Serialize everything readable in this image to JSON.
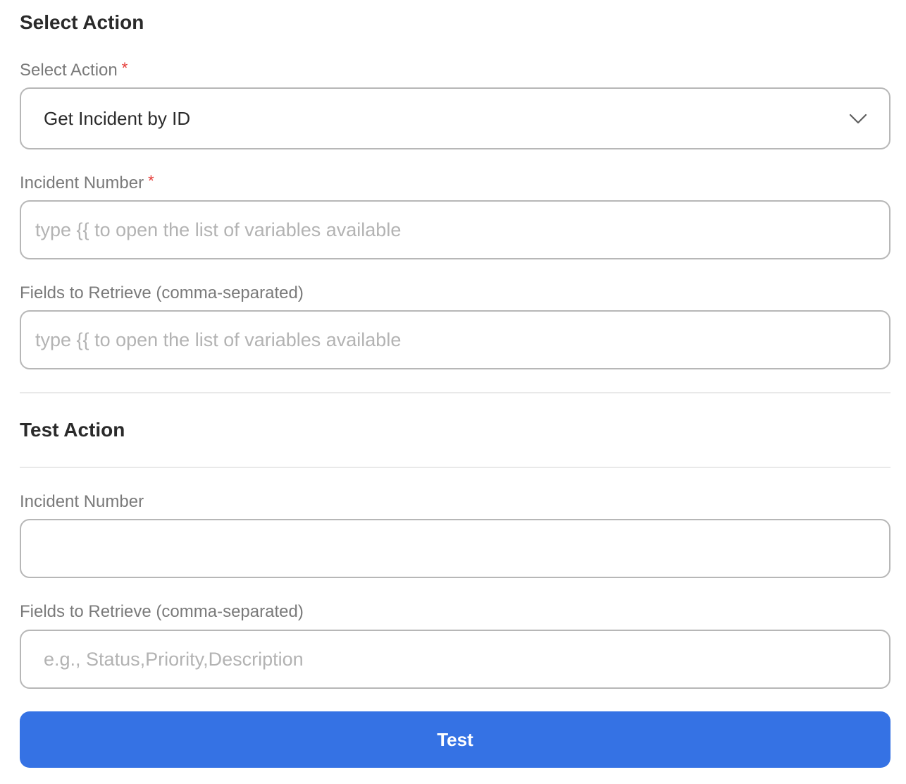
{
  "select_action_section": {
    "title": "Select Action",
    "action_label": "Select Action",
    "required_mark": "*",
    "action_value": "Get Incident by ID",
    "incident_number_label": "Incident Number",
    "incident_number_placeholder": "type {{ to open the list of variables available",
    "fields_label": "Fields to Retrieve (comma-separated)",
    "fields_placeholder": "type {{ to open the list of variables available"
  },
  "test_action_section": {
    "title": "Test Action",
    "incident_number_label": "Incident Number",
    "incident_number_value": "",
    "fields_label": "Fields to Retrieve (comma-separated)",
    "fields_placeholder": "e.g., Status,Priority,Description",
    "test_button_label": "Test"
  },
  "colors": {
    "accent": "#3572e4",
    "required": "#e53935",
    "border": "#b7b7b7",
    "label": "#7a7a7a"
  },
  "icons": {
    "dropdown": "chevron-down-icon"
  }
}
